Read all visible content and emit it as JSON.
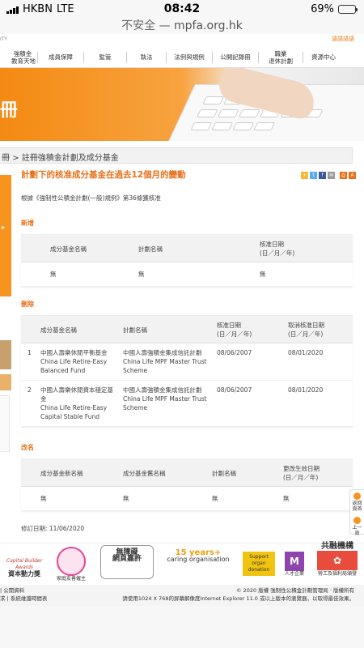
{
  "status_bar": {
    "carrier": "HKBN",
    "network": "LTE",
    "time": "08:42",
    "battery": "69%",
    "battery_level": 0.69
  },
  "browser": {
    "security_note": "不安全",
    "separator": "—",
    "domain": "mpfa.org.hk"
  },
  "site_top": {
    "brand_fragment": "ITY",
    "top_link": "語語語語"
  },
  "nav": {
    "items": [
      {
        "label_line1": "強積金",
        "label_line2": "教育天地"
      },
      {
        "label_line1": "成員保障",
        "label_line2": ""
      },
      {
        "label_line1": "監管",
        "label_line2": ""
      },
      {
        "label_line1": "執法",
        "label_line2": ""
      },
      {
        "label_line1": "法例與規例",
        "label_line2": ""
      },
      {
        "label_line1": "公開記錄冊",
        "label_line2": ""
      },
      {
        "label_line1": "職業",
        "label_line2": "退休計劃"
      },
      {
        "label_line1": "資源中心",
        "label_line2": ""
      }
    ]
  },
  "banner": {
    "title": "冊"
  },
  "breadcrumb": {
    "prefix": "冊",
    "separator": ">",
    "current": "註冊強積金計劃及成分基金"
  },
  "page": {
    "title": "計劃下的核准成分基金在過去12個月的變動",
    "legal_basis": "根據《強制性公積金計劃(一般)規例》第36條獲核准"
  },
  "social": {
    "items": [
      "share-icon",
      "twitter-icon",
      "facebook-icon",
      "email-icon",
      "print-icon",
      "font-size-icon"
    ]
  },
  "new_section": {
    "heading": "新增",
    "headers": [
      "成分基金名稱",
      "計劃名稱",
      "核准日期",
      "(日／月／年)"
    ],
    "rows": [
      [
        "無",
        "無",
        "無"
      ]
    ]
  },
  "deleted_section": {
    "heading": "刪除",
    "headers": [
      "成分基金名稱",
      "計劃名稱",
      "核准日期",
      "(日／月／年)",
      "取消核准日期",
      "(日／月／年)"
    ],
    "rows": [
      {
        "no": "1",
        "fund_zh": "中國人壽樂休閒平衡基金",
        "fund_en1": "China Life Retire-Easy",
        "fund_en2": "Balanced Fund",
        "scheme_zh": "中國人壽強積金集成信託計劃",
        "scheme_en1": "China Life MPF Master Trust",
        "scheme_en2": "Scheme",
        "approved": "08/06/2007",
        "withdrawn": "08/01/2020"
      },
      {
        "no": "2",
        "fund_zh": "中國人壽樂休閒資本穩定基",
        "fund_zh2": "金",
        "fund_en1": "China Life Retire-Easy",
        "fund_en2": "Capital Stable Fund",
        "scheme_zh": "中國人壽強積金集成信託計劃",
        "scheme_en1": "China Life MPF Master Trust",
        "scheme_en2": "Scheme",
        "approved": "08/06/2007",
        "withdrawn": "08/01/2020"
      }
    ]
  },
  "renamed_section": {
    "heading": "改名",
    "headers": [
      "成分基金新名稱",
      "成分基金舊名稱",
      "計劃名稱",
      "更改生效日期",
      "(日／月／年)"
    ],
    "rows": [
      [
        "無",
        "無",
        "無",
        "無"
      ]
    ]
  },
  "revised_date": "修訂日期: 11/06/2020",
  "float_right": {
    "top_label": "返回頁首",
    "top_line1": "返回",
    "top_line2": "頁首",
    "up_label": "上一頁"
  },
  "awards": {
    "items": [
      {
        "line1": "Capital Builder Awards",
        "line2": "資本動力獎"
      },
      {
        "line1": "",
        "line2": "家庭友善僱主"
      },
      {
        "line1": "無障礙",
        "line2": "網頁嘉許"
      },
      {
        "line1": "15 years+",
        "line2": "caring organisation"
      },
      {
        "line1": "Support organ",
        "line2": "donation"
      },
      {
        "line1": "",
        "line2": "人才企業"
      },
      {
        "line1": "共融機構",
        "line2": "勞工及福利局頒發"
      }
    ]
  },
  "footer": {
    "left_line1": "| 公開資料",
    "left_line2": "求 | 系統維護時間表",
    "copyright": "© 2020 版權 強制性公積金計劃管理局 · 版權所有",
    "browser_note": "請使用1024 X 768的屏幕解像度Internet Explorer 11.0 或以上版本的瀏覽器，以取得最佳效果。"
  },
  "colors": {
    "accent": "#e8701a",
    "brand_orange": "#f7941d",
    "table_header_bg": "#f2f2f2"
  }
}
